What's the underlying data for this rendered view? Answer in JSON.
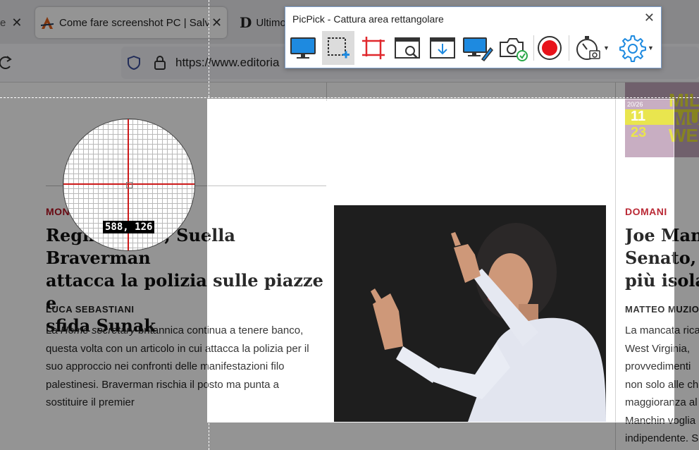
{
  "browser": {
    "tabs": [
      {
        "title": "e",
        "close": "✕"
      },
      {
        "title": "Come fare screenshot PC | Salva",
        "close": "✕"
      },
      {
        "title": "Ultimo",
        "icon_letter": "D"
      }
    ],
    "url": "https://www.editoria"
  },
  "page": {
    "left_article": {
      "kicker": "MON",
      "headline_lines": [
        "Regno Unito, Suella Braverman",
        "attacca la polizia sulle piazze e",
        "sfida Sunak"
      ],
      "author": "LUCA SEBASTIANI",
      "body": {
        "pre": "La ",
        "em": "Home secretary",
        "post": " britannica continua a tenere banco, questa volta con un articolo in cui attacca la polizia per il suo approccio nei confronti delle manifestazioni filo palestinesi. Braverman rischia il posto ma punta a sostituire il premier"
      }
    },
    "right_article": {
      "kicker": "DOMANI",
      "headline_lines": [
        "Joe Manc",
        "Senato, l",
        "più isola"
      ],
      "author": "MATTEO MUZIO",
      "body_lines": [
        "La mancata rica",
        "West Virginia,",
        "provvedimenti",
        "non solo alle ch",
        "maggioranza al",
        "Manchin voglia",
        "indipendente. S"
      ]
    },
    "ad": {
      "small": "20/26",
      "num1": "11",
      "num2": "23",
      "word1": "MILA",
      "word2": "MU",
      "word3": "WE"
    }
  },
  "capture": {
    "coordinates": "588, 126"
  },
  "picpick": {
    "title": "PicPick - Cattura area rettangolare",
    "close": "✕",
    "tools": [
      {
        "icon": "full-screen-icon",
        "selected": false
      },
      {
        "icon": "rectangle-region-icon",
        "selected": true
      },
      {
        "icon": "fixed-region-icon",
        "selected": false
      },
      {
        "icon": "window-capture-icon",
        "selected": false
      },
      {
        "icon": "scroll-capture-icon",
        "selected": false
      },
      {
        "icon": "freehand-icon",
        "selected": false
      },
      {
        "icon": "repeat-capture-icon",
        "selected": false
      },
      {
        "icon": "record-icon",
        "selected": false
      },
      {
        "icon": "timer-icon",
        "selected": false
      },
      {
        "icon": "settings-gear-icon",
        "selected": false
      }
    ],
    "colors": {
      "accent": "#1e8ae0",
      "crop": "#e0282d",
      "record": "#e8131b",
      "check": "#2aa84a"
    }
  }
}
